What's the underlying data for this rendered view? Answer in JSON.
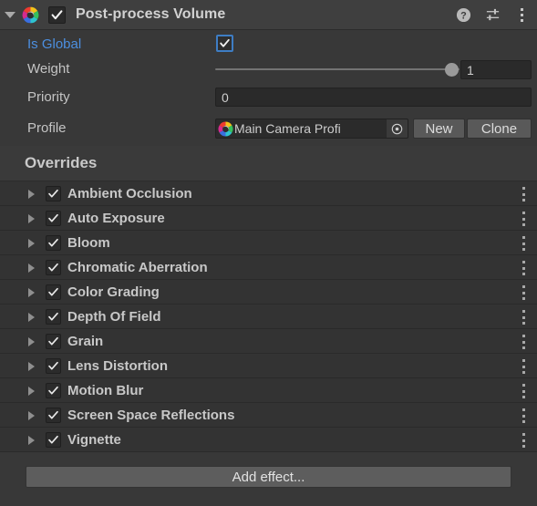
{
  "component": {
    "title": "Post-process Volume",
    "enabled": true,
    "foldout_expanded": true,
    "icon": "aperture-icon",
    "header_icons": [
      {
        "name": "help-icon",
        "glyph": "?"
      },
      {
        "name": "preset-icon",
        "glyph": "sliders"
      },
      {
        "name": "context-menu-icon",
        "glyph": "kebab"
      }
    ]
  },
  "properties": {
    "is_global": {
      "label": "Is Global",
      "value": true,
      "is_override": true,
      "override_color": "#4c8fe0"
    },
    "weight": {
      "label": "Weight",
      "value": "1",
      "slider_min": 0,
      "slider_max": 1,
      "slider_fraction": 1.0
    },
    "priority": {
      "label": "Priority",
      "value": "0",
      "placeholder": ""
    },
    "profile": {
      "label": "Profile",
      "value": "Main Camera Profi",
      "icon": "aperture-icon",
      "picker_icon": "object-picker-icon",
      "new_button": "New",
      "clone_button": "Clone"
    }
  },
  "overrides": {
    "title": "Overrides",
    "effects": [
      {
        "name": "Ambient Occlusion",
        "enabled": true,
        "expanded": false
      },
      {
        "name": "Auto Exposure",
        "enabled": true,
        "expanded": false
      },
      {
        "name": "Bloom",
        "enabled": true,
        "expanded": false
      },
      {
        "name": "Chromatic Aberration",
        "enabled": true,
        "expanded": false
      },
      {
        "name": "Color Grading",
        "enabled": true,
        "expanded": false
      },
      {
        "name": "Depth Of Field",
        "enabled": true,
        "expanded": false
      },
      {
        "name": "Grain",
        "enabled": true,
        "expanded": false
      },
      {
        "name": "Lens Distortion",
        "enabled": true,
        "expanded": false
      },
      {
        "name": "Motion Blur",
        "enabled": true,
        "expanded": false
      },
      {
        "name": "Screen Space Reflections",
        "enabled": true,
        "expanded": false
      },
      {
        "name": "Vignette",
        "enabled": true,
        "expanded": false
      }
    ],
    "add_effect_label": "Add effect..."
  },
  "colors": {
    "window_bg": "#383838",
    "header_bg": "#3f3f3f",
    "row_bg": "#333333",
    "field_bg": "#2a2a2a",
    "button_bg": "#595959",
    "text": "#c8c8c8",
    "override_blue": "#4c8fe0"
  }
}
